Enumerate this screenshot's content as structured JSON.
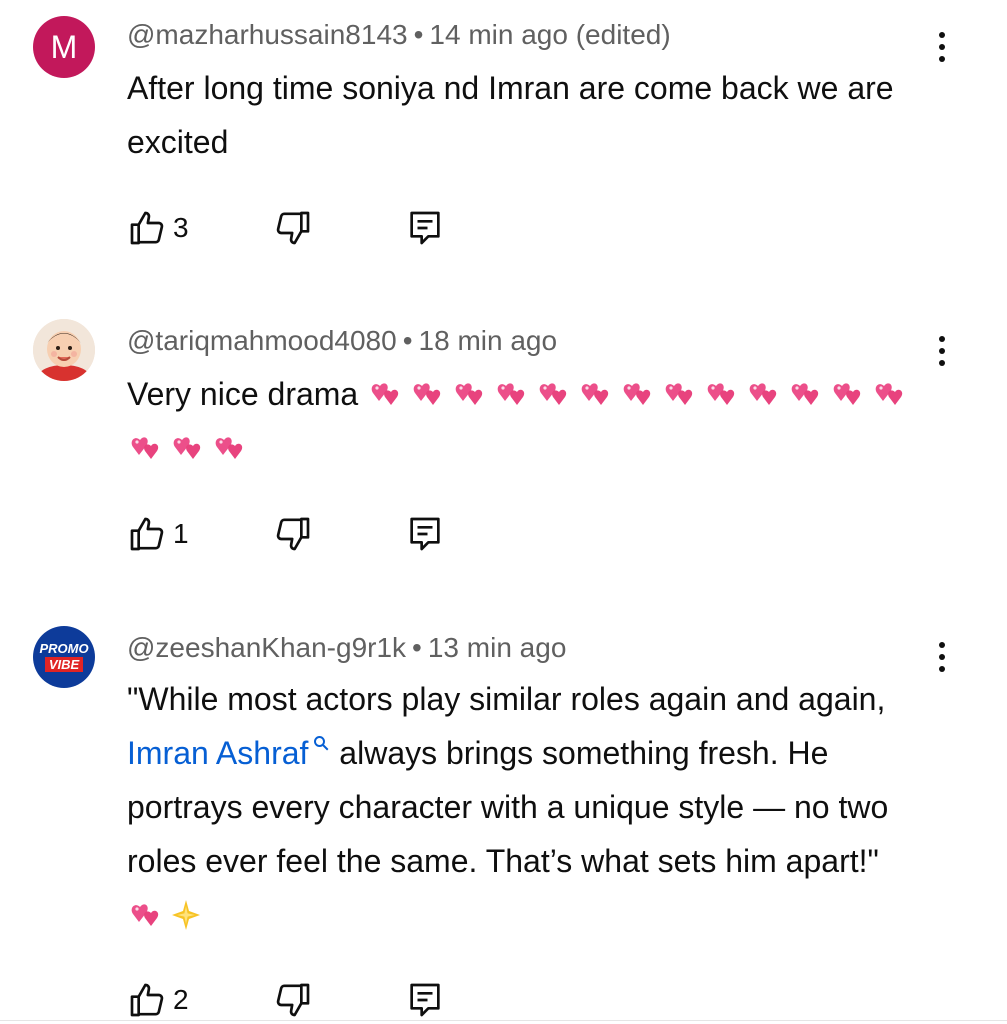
{
  "comments": [
    {
      "avatar_letter": "M",
      "handle": "@mazharhussain8143",
      "time": "14 min ago (edited)",
      "text": "After long time soniya nd Imran are come back we are excited",
      "likes": "3"
    },
    {
      "handle": "@tariqmahmood4080",
      "time": "18 min ago",
      "text": "Very nice drama",
      "likes": "1",
      "emoji_count": 16,
      "emoji": "two-hearts-icon"
    },
    {
      "avatar_text_top": "PROMO",
      "avatar_text_bottom": "VIBE",
      "handle": "@zeeshanKhan-g9r1k",
      "time": "13 min ago",
      "text_before_link": "\"While most actors play similar roles again and again, ",
      "link_text": "Imran Ashraf",
      "text_after_link": " always brings something fresh. He portrays every character with a unique style — no two roles ever feel the same. That’s what sets him apart!\"",
      "likes": "2"
    }
  ],
  "separator": "•",
  "colors": {
    "avatar_m": "#c2185b",
    "link": "#065fd4",
    "meta": "#606060",
    "heart": "#ec4f8a"
  }
}
